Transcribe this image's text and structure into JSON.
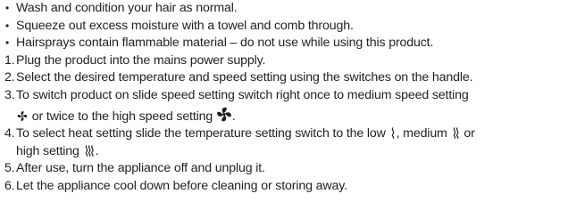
{
  "bullets": [
    "Wash and condition your hair as normal.",
    "Squeeze out excess moisture with a towel and comb through.",
    "Hairsprays contain flammable material – do not use while using this product."
  ],
  "steps": [
    {
      "num": "1.",
      "text": "Plug the product into the mains power supply."
    },
    {
      "num": "2.",
      "text": "Select the desired temperature and speed setting using the switches on the handle."
    },
    {
      "num": "3.",
      "a": "To switch product on slide speed setting switch right once to medium speed setting",
      "b": "or twice to the high speed setting",
      "c": "."
    },
    {
      "num": "4.",
      "a": "To select heat setting slide the temperature setting switch to the low",
      "b": ", medium",
      "c": "or",
      "d": "high setting",
      "e": "."
    },
    {
      "num": "5.",
      "text": "After use, turn the appliance off and unplug it."
    },
    {
      "num": "6.",
      "text": "Let the appliance cool down before cleaning or storing away."
    }
  ],
  "icons": {
    "fan_medium": "fan-medium-icon",
    "fan_high": "fan-high-icon",
    "heat_low": "heat-low-icon",
    "heat_medium": "heat-medium-icon",
    "heat_high": "heat-high-icon"
  },
  "text_color": "#231f20"
}
